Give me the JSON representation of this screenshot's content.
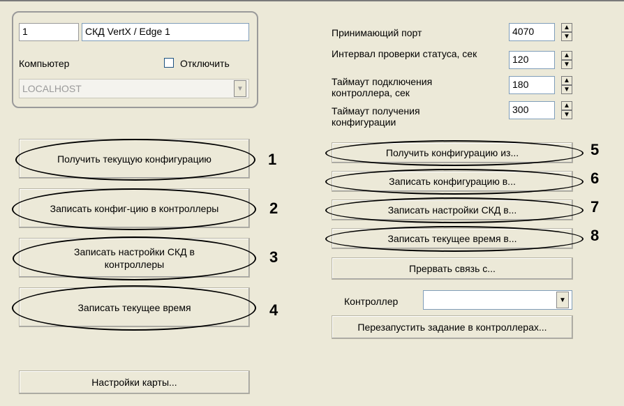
{
  "controller": {
    "id": "1",
    "name": "СКД VertX / Edge 1",
    "computer_label": "Компьютер",
    "disable_label": "Отключить",
    "computer_value": "LOCALHOST"
  },
  "settings": [
    {
      "label": "Принимающий порт",
      "value": "4070"
    },
    {
      "label": "Интервал проверки статуса, сек",
      "value": "120"
    },
    {
      "label": "Таймаут подключения контроллера, сек",
      "value": "180"
    },
    {
      "label": "Таймаут получения конфигурации",
      "value": "300"
    }
  ],
  "left_buttons": [
    {
      "label": "Получить текущую конфигурацию",
      "marker": "1"
    },
    {
      "label": "Записать конфиг-цию в контроллеры",
      "marker": "2"
    },
    {
      "label": "Записать настройки СКД в контроллеры",
      "marker": "3"
    },
    {
      "label": "Записать текущее время",
      "marker": "4"
    }
  ],
  "map_settings_label": "Настройки карты...",
  "right_buttons": [
    {
      "label": "Получить конфигурацию из...",
      "marker": "5"
    },
    {
      "label": "Записать конфигурацию в...",
      "marker": "6"
    },
    {
      "label": "Записать настройки СКД в...",
      "marker": "7"
    },
    {
      "label": "Записать текущее время в...",
      "marker": "8"
    }
  ],
  "break_connection_label": "Прервать связь с...",
  "controller_select_label": "Контроллер",
  "controller_select_value": "",
  "restart_task_label": "Перезапустить задание в контроллерах...",
  "icons": {
    "spin_up": "▲",
    "spin_down": "▼",
    "dropdown": "▼"
  }
}
